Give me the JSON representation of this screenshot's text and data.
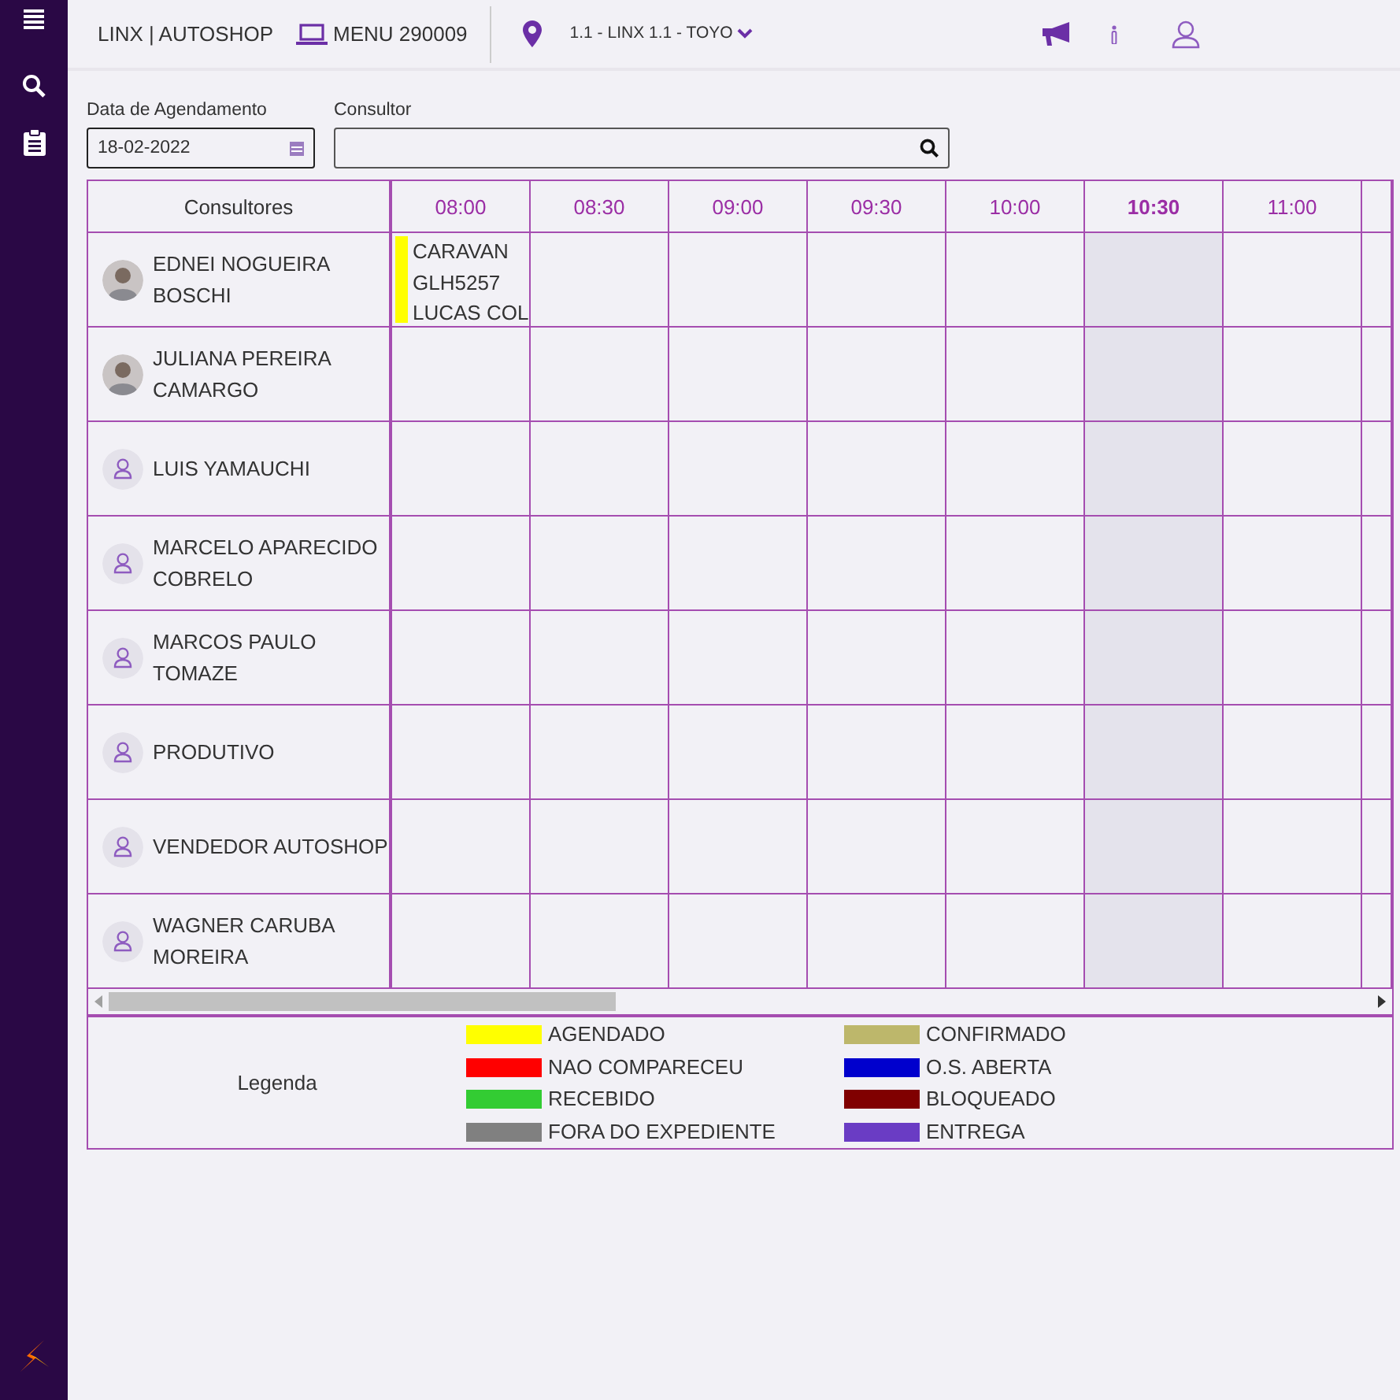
{
  "header": {
    "brand": "LINX | AUTOSHOP",
    "menu": "MENU 290009",
    "location": "1.1 - LINX 1.1 - TOYO"
  },
  "filters": {
    "date_label": "Data de Agendamento",
    "date_value": "18-02-2022",
    "consultant_label": "Consultor"
  },
  "schedule": {
    "first_column": "Consultores",
    "slots": [
      {
        "time": "08:00",
        "selected": false
      },
      {
        "time": "08:30",
        "selected": false
      },
      {
        "time": "09:00",
        "selected": false
      },
      {
        "time": "09:30",
        "selected": false
      },
      {
        "time": "10:00",
        "selected": false
      },
      {
        "time": "10:30",
        "selected": true
      },
      {
        "time": "11:00",
        "selected": false
      }
    ],
    "consultants": [
      {
        "name": "EDNEI NOGUEIRA BOSCHI",
        "kind": "photo",
        "cells": [
          {
            "kind": "appointment",
            "color": "#ffff00",
            "lines": [
              "CARAVAN",
              "GLH5257",
              "LUCAS COL"
            ]
          },
          {
            "kind": "free"
          },
          {
            "kind": "free"
          },
          {
            "kind": "free"
          },
          {
            "kind": "free"
          },
          {
            "kind": "free"
          },
          {
            "kind": "free"
          }
        ]
      },
      {
        "name": "JULIANA PEREIRA CAMARGO",
        "kind": "photo"
      },
      {
        "name": "LUIS YAMAUCHI",
        "kind": "placeholder"
      },
      {
        "name": "MARCELO APARECIDO COBRELO",
        "kind": "placeholder"
      },
      {
        "name": "MARCOS PAULO TOMAZE",
        "kind": "placeholder"
      },
      {
        "name": "PRODUTIVO",
        "kind": "placeholder"
      },
      {
        "name": "VENDEDOR AUTOSHOP",
        "kind": "placeholder"
      },
      {
        "name": "WAGNER CARUBA MOREIRA",
        "kind": "placeholder"
      }
    ]
  },
  "legend": {
    "title": "Legenda",
    "items": [
      {
        "label": "AGENDADO",
        "color": "#ffff00"
      },
      {
        "label": "NAO COMPARECEU",
        "color": "#ff0000"
      },
      {
        "label": "RECEBIDO",
        "color": "#33cc33"
      },
      {
        "label": "FORA DO EXPEDIENTE",
        "color": "#808080"
      },
      {
        "label": "CONFIRMADO",
        "color": "#bdb76b"
      },
      {
        "label": "O.S. ABERTA",
        "color": "#0000cd"
      },
      {
        "label": "BLOQUEADO",
        "color": "#800000"
      },
      {
        "label": "ENTREGA",
        "color": "#6a3cc4"
      }
    ]
  }
}
